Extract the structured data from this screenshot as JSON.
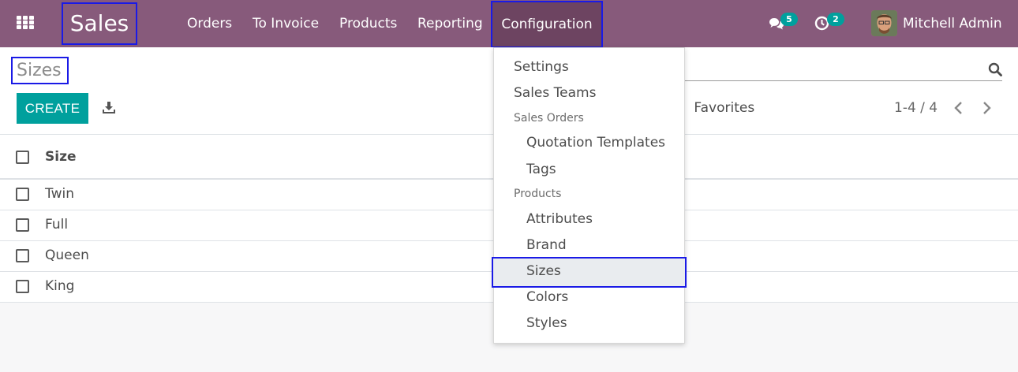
{
  "navbar": {
    "app_title": "Sales",
    "menu": {
      "orders": "Orders",
      "to_invoice": "To Invoice",
      "products": "Products",
      "reporting": "Reporting",
      "configuration": "Configuration"
    },
    "messages_count": "5",
    "activities_count": "2",
    "user_name": "Mitchell Admin"
  },
  "control_panel": {
    "breadcrumb": "Sizes",
    "create_label": "CREATE",
    "favorites_label": "Favorites",
    "pager": "1-4 / 4"
  },
  "list": {
    "column_header": "Size",
    "rows": [
      "Twin",
      "Full",
      "Queen",
      "King"
    ]
  },
  "config_menu": {
    "settings": "Settings",
    "sales_teams": "Sales Teams",
    "sales_orders_header": "Sales Orders",
    "quotation_templates": "Quotation Templates",
    "tags": "Tags",
    "products_header": "Products",
    "attributes": "Attributes",
    "brand": "Brand",
    "sizes": "Sizes",
    "colors": "Colors",
    "styles": "Styles"
  },
  "colors": {
    "navbar": "#875a7b",
    "accent": "#00a09d",
    "highlight_border": "#1a1ae6"
  }
}
